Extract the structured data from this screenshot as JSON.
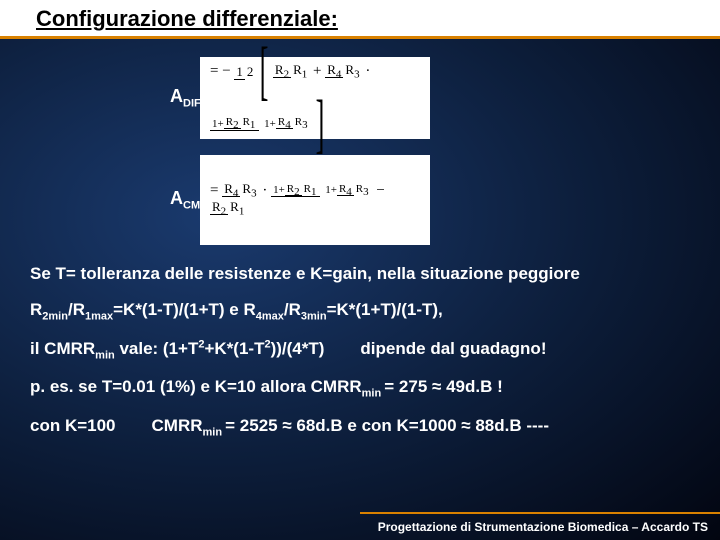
{
  "title": "Configurazione differenziale:",
  "labels": {
    "adif_a": "A",
    "adif_sub": "DIF",
    "acm_a": "A",
    "acm_sub": "CM"
  },
  "eq": {
    "adif_prefix": "= −",
    "half_n": "1",
    "half_d": "2",
    "r2": "R",
    "r2s": "2",
    "r1": "R",
    "r1s": "1",
    "plus": "+",
    "r4": "R",
    "r4s": "4",
    "r3": "R",
    "r3s": "3",
    "one": "1",
    "dot": "·",
    "acm_prefix": "=",
    "minus": "−"
  },
  "lines": {
    "l1a": "Se T= tolleranza delle resistenze e K=gain, nella situazione peggiore",
    "l2a": "R",
    "l2b": "2min",
    "l2c": "/R",
    "l2d": "1max",
    "l2e": "=K*(1-T)/(1+T) e R",
    "l2f": "4max",
    "l2g": "/R",
    "l2h": "3min",
    "l2i": "=K*(1+T)/(1-T),",
    "l3a": "il CMRR",
    "l3b": "min",
    "l3c": " vale:  (1+T",
    "l3d": "2",
    "l3e": "+K*(1-T",
    "l3f": "2",
    "l3g": "))/(4*T)",
    "l3h": "dipende dal guadagno!",
    "l4a": "p. es. se T=0.01 (1%) e K=10  allora CMRR",
    "l4b": "min ",
    "l4c": "= 275 ≈ 49d.B !",
    "l5a": "con K=100",
    "l5b": "CMRR",
    "l5c": "min ",
    "l5d": "= 2525 ≈ 68d.B e con K=1000 ≈ 88d.B  ----"
  },
  "footer": "Progettazione di Strumentazione Biomedica – Accardo TS"
}
